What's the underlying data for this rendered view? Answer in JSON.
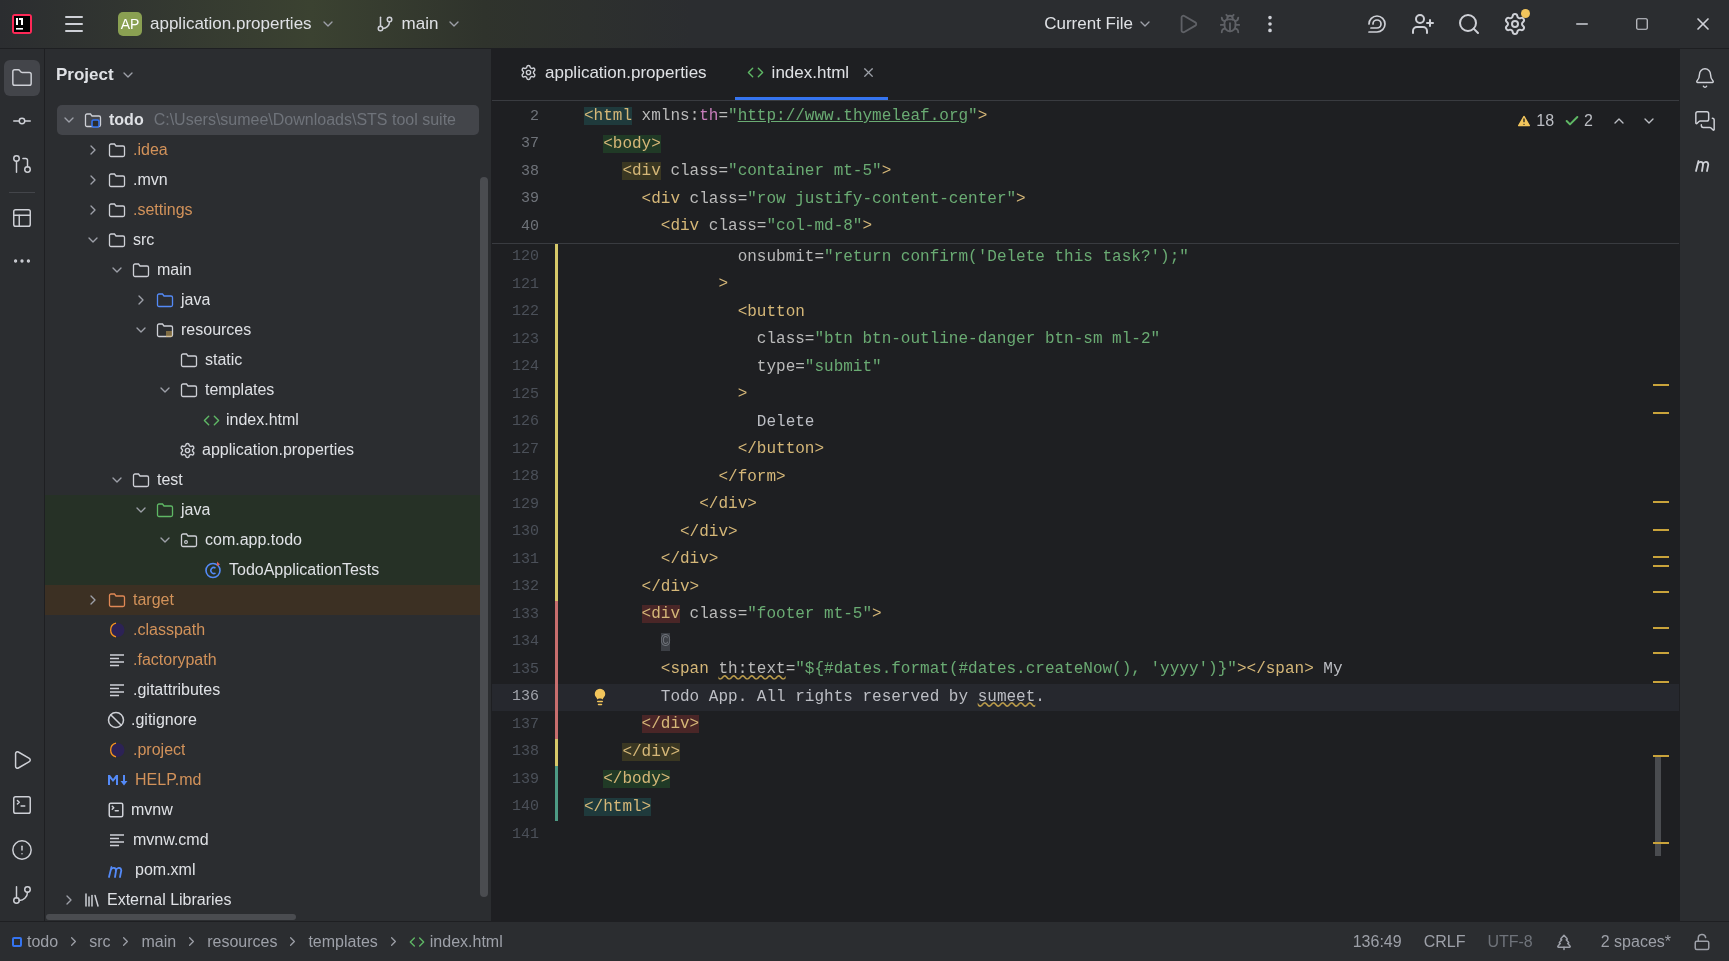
{
  "title_bar": {
    "project_badge": "AP",
    "project_name": "application.properties",
    "branch": "main",
    "run_config": "Current File",
    "settings_notification": true
  },
  "tool_strip_left": {
    "top": [
      {
        "kind": "project",
        "selected": true
      },
      {
        "kind": "commit",
        "selected": false
      },
      {
        "kind": "pull-requests",
        "selected": false
      },
      {
        "kind": "structure",
        "selected": false
      },
      {
        "kind": "more",
        "selected": false
      }
    ],
    "bottom": [
      {
        "kind": "run",
        "selected": false
      },
      {
        "kind": "terminal",
        "selected": false
      },
      {
        "kind": "problems",
        "selected": false
      },
      {
        "kind": "git",
        "selected": false
      }
    ]
  },
  "project": {
    "title": "Project",
    "tree": [
      {
        "label": "todo",
        "path": "C:\\Users\\sumee\\Downloads\\STS tool suite",
        "kind": "module",
        "expanded": true,
        "selected": true,
        "ignored": false,
        "children": [
          {
            "label": ".idea",
            "kind": "folder",
            "expanded": false,
            "selected": false,
            "ignored": true
          },
          {
            "label": ".mvn",
            "kind": "folder",
            "expanded": false,
            "selected": false,
            "ignored": false
          },
          {
            "label": ".settings",
            "kind": "folder",
            "expanded": false,
            "selected": false,
            "ignored": true
          },
          {
            "label": "src",
            "kind": "folder",
            "expanded": true,
            "selected": false,
            "ignored": false,
            "children": [
              {
                "label": "main",
                "kind": "folder",
                "expanded": true,
                "selected": false,
                "ignored": false,
                "children": [
                  {
                    "label": "java",
                    "kind": "source-folder",
                    "expanded": false,
                    "selected": false,
                    "ignored": false
                  },
                  {
                    "label": "resources",
                    "kind": "resource-folder",
                    "expanded": true,
                    "selected": false,
                    "ignored": false,
                    "children": [
                      {
                        "label": "static",
                        "kind": "folder",
                        "selected": false,
                        "ignored": false
                      },
                      {
                        "label": "templates",
                        "kind": "folder",
                        "expanded": true,
                        "selected": false,
                        "ignored": false,
                        "children": [
                          {
                            "label": "index.html",
                            "kind": "html",
                            "selected": false,
                            "ignored": false
                          }
                        ]
                      },
                      {
                        "label": "application.properties",
                        "kind": "properties",
                        "selected": false,
                        "ignored": false
                      }
                    ]
                  }
                ]
              },
              {
                "label": "test",
                "kind": "folder",
                "expanded": true,
                "selected": false,
                "ignored": false,
                "children": [
                  {
                    "label": "java",
                    "kind": "test-folder",
                    "expanded": true,
                    "selected": false,
                    "ignored": false,
                    "color": "#263126",
                    "children": [
                      {
                        "label": "com.app.todo",
                        "kind": "package",
                        "expanded": true,
                        "selected": false,
                        "ignored": false,
                        "color": "#263126",
                        "children": [
                          {
                            "label": "TodoApplicationTests",
                            "kind": "test-class",
                            "selected": false,
                            "ignored": false,
                            "color": "#263126"
                          }
                        ]
                      }
                    ]
                  }
                ]
              }
            ]
          },
          {
            "label": "target",
            "kind": "excluded-folder",
            "expanded": false,
            "selected": false,
            "ignored": true,
            "color": "#3c3023"
          },
          {
            "label": ".classpath",
            "kind": "eclipse",
            "selected": false,
            "ignored": true
          },
          {
            "label": ".factorypath",
            "kind": "text",
            "selected": false,
            "ignored": true
          },
          {
            "label": ".gitattributes",
            "kind": "text",
            "selected": false,
            "ignored": false
          },
          {
            "label": ".gitignore",
            "kind": "ignore",
            "selected": false,
            "ignored": false
          },
          {
            "label": ".project",
            "kind": "eclipse",
            "selected": false,
            "ignored": true
          },
          {
            "label": "HELP.md",
            "kind": "markdown",
            "selected": false,
            "ignored": true
          },
          {
            "label": "mvnw",
            "kind": "shell",
            "selected": false,
            "ignored": false
          },
          {
            "label": "mvnw.cmd",
            "kind": "text",
            "selected": false,
            "ignored": false
          },
          {
            "label": "pom.xml",
            "kind": "maven",
            "selected": false,
            "ignored": false
          }
        ]
      },
      {
        "label": "External Libraries",
        "kind": "library",
        "expanded": false,
        "selected": false,
        "ignored": false
      }
    ]
  },
  "tabs": [
    {
      "label": "application.properties",
      "kind": "properties",
      "selected": false,
      "closable": false
    },
    {
      "label": "index.html",
      "kind": "html",
      "selected": true,
      "closable": true
    }
  ],
  "inspections": {
    "warnings": "18",
    "weak_warnings": "2"
  },
  "sticky_lines": [
    {
      "number": "2",
      "tokens": [
        {
          "text": "<html",
          "kind": "tag",
          "color": "#1f3a3c"
        },
        {
          "text": " xmlns:",
          "kind": "attr"
        },
        {
          "text": "th",
          "kind": "ns"
        },
        {
          "text": "=",
          "kind": "attr"
        },
        {
          "text": "\"",
          "kind": "str"
        },
        {
          "text": "http://www.thymeleaf.org",
          "kind": "link"
        },
        {
          "text": "\"",
          "kind": "str"
        },
        {
          "text": ">",
          "kind": "tag"
        }
      ]
    },
    {
      "number": "37",
      "tokens": [
        {
          "text": "  <body>",
          "kind": "tag",
          "color": "#203a26"
        }
      ]
    },
    {
      "number": "38",
      "tokens": [
        {
          "text": "    <div",
          "kind": "tag",
          "color": "#3a3722"
        },
        {
          "text": " class=",
          "kind": "attr"
        },
        {
          "text": "\"container mt-5\"",
          "kind": "str"
        },
        {
          "text": ">",
          "kind": "tag"
        }
      ]
    },
    {
      "number": "39",
      "tokens": [
        {
          "text": "      <div",
          "kind": "tag"
        },
        {
          "text": " class=",
          "kind": "attr"
        },
        {
          "text": "\"row justify-content-center\"",
          "kind": "str"
        },
        {
          "text": ">",
          "kind": "tag"
        }
      ]
    },
    {
      "number": "40",
      "tokens": [
        {
          "text": "        <div",
          "kind": "tag"
        },
        {
          "text": " class=",
          "kind": "attr"
        },
        {
          "text": "\"col-md-8\"",
          "kind": "str"
        },
        {
          "text": ">",
          "kind": "tag"
        }
      ]
    }
  ],
  "lines": [
    {
      "number": "120",
      "color": "#d6c869",
      "current": false,
      "tokens": [
        {
          "text": "                onsubmit=",
          "kind": "attr"
        },
        {
          "text": "\"return confirm('Delete this task?');\"",
          "kind": "str"
        }
      ]
    },
    {
      "number": "121",
      "color": "#d6c869",
      "current": false,
      "tokens": [
        {
          "text": "              >",
          "kind": "tag"
        }
      ]
    },
    {
      "number": "122",
      "color": "#d6c869",
      "current": false,
      "tokens": [
        {
          "text": "                <button",
          "kind": "tag"
        }
      ]
    },
    {
      "number": "123",
      "color": "#d6c869",
      "current": false,
      "tokens": [
        {
          "text": "                  class=",
          "kind": "attr"
        },
        {
          "text": "\"btn btn-outline-danger btn-sm ml-2\"",
          "kind": "str"
        }
      ]
    },
    {
      "number": "124",
      "color": "#d6c869",
      "current": false,
      "tokens": [
        {
          "text": "                  type=",
          "kind": "attr"
        },
        {
          "text": "\"submit\"",
          "kind": "str"
        }
      ]
    },
    {
      "number": "125",
      "color": "#d6c869",
      "current": false,
      "tokens": [
        {
          "text": "                >",
          "kind": "tag"
        }
      ]
    },
    {
      "number": "126",
      "color": "#d6c869",
      "current": false,
      "tokens": [
        {
          "text": "                  Delete",
          "kind": "text"
        }
      ]
    },
    {
      "number": "127",
      "color": "#d6c869",
      "current": false,
      "tokens": [
        {
          "text": "                </button>",
          "kind": "tag"
        }
      ]
    },
    {
      "number": "128",
      "color": "#d6c869",
      "current": false,
      "tokens": [
        {
          "text": "              </form>",
          "kind": "tag"
        }
      ]
    },
    {
      "number": "129",
      "color": "#d6c869",
      "current": false,
      "tokens": [
        {
          "text": "            </div>",
          "kind": "tag"
        }
      ]
    },
    {
      "number": "130",
      "color": "#d6c869",
      "current": false,
      "tokens": [
        {
          "text": "          </div>",
          "kind": "tag"
        }
      ]
    },
    {
      "number": "131",
      "color": "#d6c869",
      "current": false,
      "tokens": [
        {
          "text": "        </div>",
          "kind": "tag"
        }
      ]
    },
    {
      "number": "132",
      "color": "#d6c869",
      "current": false,
      "tokens": [
        {
          "text": "      </div>",
          "kind": "tag"
        }
      ]
    },
    {
      "number": "133",
      "color": "#c86e6e",
      "current": false,
      "tokens": [
        {
          "text": "      <div",
          "kind": "tag",
          "color": "#4a2627"
        },
        {
          "text": " class=",
          "kind": "attr"
        },
        {
          "text": "\"footer mt-5\"",
          "kind": "str"
        },
        {
          "text": ">",
          "kind": "tag"
        }
      ]
    },
    {
      "number": "134",
      "color": "#c86e6e",
      "current": false,
      "tokens": [
        {
          "text": "        ©",
          "kind": "dim",
          "color": "#3c3f45"
        }
      ]
    },
    {
      "number": "135",
      "color": "#c86e6e",
      "current": false,
      "tokens": [
        {
          "text": "        <span ",
          "kind": "tag"
        },
        {
          "text": "th:text",
          "kind": "attr",
          "flagged": true
        },
        {
          "text": "=",
          "kind": "attr"
        },
        {
          "text": "\"${#dates.format(#dates.createNow(), 'yyyy')}\"",
          "kind": "str"
        },
        {
          "text": "></span>",
          "kind": "tag"
        },
        {
          "text": " My",
          "kind": "text"
        }
      ]
    },
    {
      "number": "136",
      "color": "#c86e6e",
      "current": true,
      "tokens": [
        {
          "text": "        Todo App. All rights reserved by ",
          "kind": "text"
        },
        {
          "text": "sumeet",
          "kind": "text",
          "flagged": true
        },
        {
          "text": ".",
          "kind": "text"
        }
      ]
    },
    {
      "number": "137",
      "color": "#c86e6e",
      "current": false,
      "tokens": [
        {
          "text": "      </div>",
          "kind": "tag",
          "color": "#4a2627"
        }
      ]
    },
    {
      "number": "138",
      "color": "#d6c869",
      "current": false,
      "tokens": [
        {
          "text": "    </div>",
          "kind": "tag",
          "color": "#3a3722"
        }
      ]
    },
    {
      "number": "139",
      "color": "#4d9a84",
      "current": false,
      "tokens": [
        {
          "text": "  </body>",
          "kind": "tag",
          "color": "#203a26"
        }
      ]
    },
    {
      "number": "140",
      "color": "#4d9a84",
      "current": false,
      "tokens": [
        {
          "text": "</html>",
          "kind": "tag",
          "color": "#1f3a3c"
        }
      ]
    },
    {
      "number": "141",
      "current": false
    }
  ],
  "tool_strip_right": [
    {
      "kind": "notifications",
      "selected": false
    },
    {
      "kind": "ai-chat",
      "selected": false
    },
    {
      "kind": "maven",
      "selected": false
    }
  ],
  "status_bar": {
    "breadcrumbs": [
      {
        "label": "todo",
        "kind": "module"
      },
      {
        "label": "src",
        "kind": "folder"
      },
      {
        "label": "main",
        "kind": "folder"
      },
      {
        "label": "resources",
        "kind": "folder"
      },
      {
        "label": "templates",
        "kind": "folder"
      },
      {
        "label": "index.html",
        "kind": "html"
      }
    ],
    "position": "136:49",
    "line_separator": "CRLF",
    "encoding": "UTF-8",
    "indent": "2 spaces*"
  }
}
